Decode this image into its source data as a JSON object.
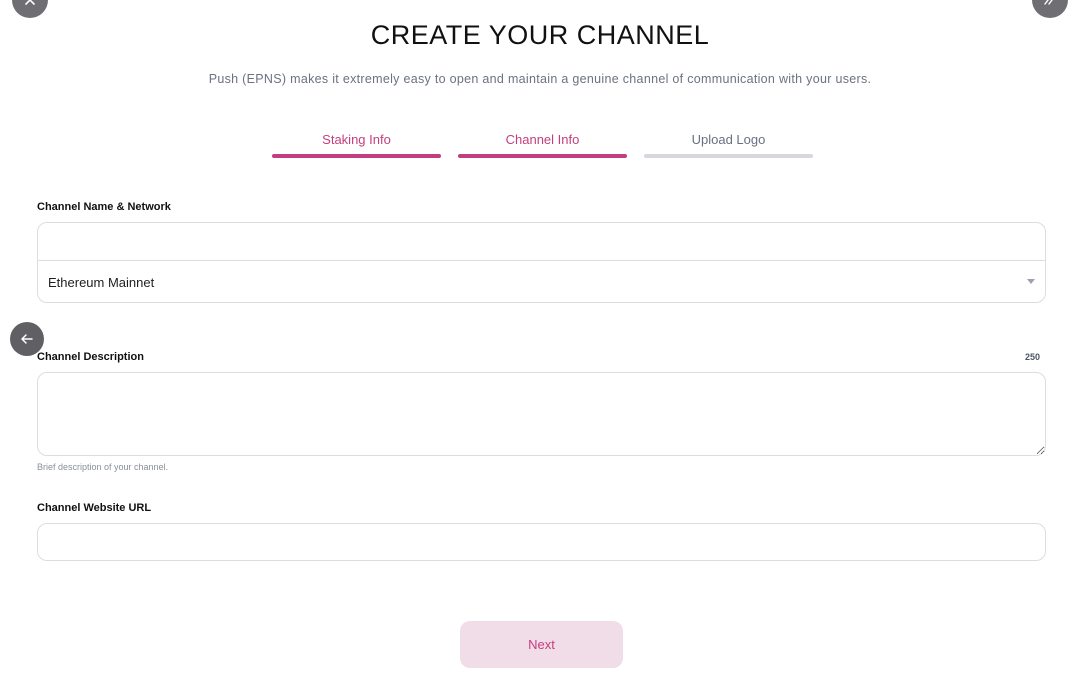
{
  "header": {
    "title": "CREATE YOUR CHANNEL",
    "subtitle": "Push (EPNS) makes it extremely easy to open and maintain a genuine channel of communication with your users."
  },
  "steps": [
    {
      "label": "Staking Info",
      "state": "active"
    },
    {
      "label": "Channel Info",
      "state": "active"
    },
    {
      "label": "Upload Logo",
      "state": "inactive"
    }
  ],
  "form": {
    "channel_name": {
      "label": "Channel Name & Network",
      "value": "",
      "network_selected": "Ethereum Mainnet"
    },
    "description": {
      "label": "Channel Description",
      "char_count": "250",
      "value": "",
      "hint": "Brief description of your channel."
    },
    "website": {
      "label": "Channel Website URL",
      "value": ""
    }
  },
  "actions": {
    "next_label": "Next"
  },
  "colors": {
    "accent": "#c43e7f",
    "accent_light": "#f0dde8",
    "inactive_bar": "#d6d8de",
    "border": "#dcdde2"
  },
  "icons": {
    "top_left": "close-icon",
    "top_right": "double-chevron-icon",
    "back": "arrow-left-icon",
    "dropdown": "caret-down-icon"
  }
}
